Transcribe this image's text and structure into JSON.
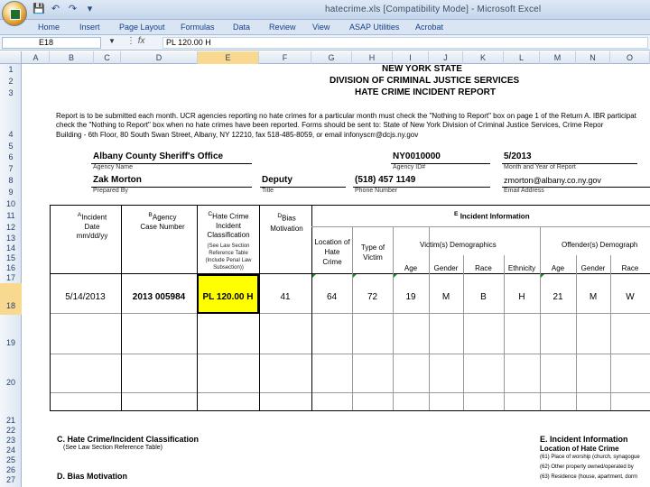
{
  "window": {
    "title": "hatecrime.xls  [Compatibility Mode] - Microsoft Excel"
  },
  "ribbon": {
    "tabs": [
      "Home",
      "Insert",
      "Page Layout",
      "Formulas",
      "Data",
      "Review",
      "View",
      "ASAP Utilities",
      "Acrobat"
    ]
  },
  "formula_bar": {
    "name_box": "E18",
    "fx": "fx",
    "content": "PL 120.00 H"
  },
  "columns": [
    "A",
    "B",
    "C",
    "D",
    "E",
    "F",
    "G",
    "H",
    "I",
    "J",
    "K",
    "L",
    "M",
    "N",
    "O"
  ],
  "rows": [
    "1",
    "2",
    "3",
    "4",
    "5",
    "6",
    "7",
    "8",
    "9",
    "10",
    "11",
    "12",
    "13",
    "14",
    "15",
    "16",
    "17",
    "18",
    "19",
    "20",
    "21",
    "22",
    "23",
    "24",
    "25",
    "26",
    "27"
  ],
  "sheet": {
    "title1": "NEW YORK STATE",
    "title2": "DIVISION OF CRIMINAL JUSTICE SERVICES",
    "title3": "HATE CRIME INCIDENT REPORT",
    "instructions1": "Report is to be submitted each month.  UCR agencies reporting no hate crimes for a particular month must check the \"Nothing to Report\" box on page 1 of the Return A.  IBR participat",
    "instructions2": "check the \"Nothing to Report\" box when no hate crimes have been reported.  Forms should be sent to:  State of New York Division of Criminal Justice Services, Crime Repor",
    "instructions3": "Building - 6th Floor, 80 South Swan Street, Albany, NY 12210,  fax 518-485-8059, or email infonyscrr@dcjs.ny.gov",
    "agency_name": "Albany County Sheriff's Office",
    "agency_name_label": "Agency Name",
    "ori": "NY0010000",
    "ori_label": "Agency ID#",
    "month_year": "5/2013",
    "month_year_label": "Month and Year of Report",
    "prepared_by": "Zak Morton",
    "prepared_by_label": "Prepared By",
    "title": "Deputy",
    "title_label": "Title",
    "phone": "(518) 457 1149",
    "phone_label": "Phone Number",
    "email": "zmorton@albany.co.ny.gov",
    "email_label": "Email Address",
    "col_a_letter": "A",
    "col_a": "Incident Date mm/dd/yy",
    "col_b_letter": "B",
    "col_b": "Agency Case Number",
    "col_c_letter": "C",
    "col_c": "Hate Crime Incident Classification",
    "col_c_note": "(See Law Section Reference Table (Include Penal Law Subsection))",
    "col_d_letter": "D",
    "col_d": "Bias Motivation",
    "col_e_letter": "E",
    "col_e": "Incident Information",
    "location": "Location of Hate Crime",
    "victim_type": "Type of Victim",
    "victims_demo": "Victim(s) Demographics",
    "offender_demo": "Offender(s) Demograph",
    "age": "Age",
    "gender": "Gender",
    "race": "Race",
    "ethnicity": "Ethnicity",
    "age2": "Age",
    "gender2": "Gender",
    "race2": "Race",
    "record": {
      "date": "5/14/2013",
      "case": "2013 005984",
      "classification": "PL 120.00 H",
      "bias": "41",
      "location": "64",
      "victim_type": "72",
      "v_age": "19",
      "v_gender": "M",
      "v_race": "B",
      "ethnicity": "H",
      "o_age": "21",
      "o_gender": "M",
      "o_race": "W"
    },
    "section_c": "C. Hate Crime/Incident Classification",
    "section_c_note": "(See Law Section Reference Table)",
    "section_d": "D. Bias Motivation",
    "section_e": "E. Incident Information",
    "section_e_sub": "Location of Hate Crime",
    "section_e_l1": "(61) Place of worship (church, synagogue",
    "section_e_l2": "(62) Other property owned/operated by",
    "section_e_l3": "(63) Residence (house, apartment, dorm"
  }
}
